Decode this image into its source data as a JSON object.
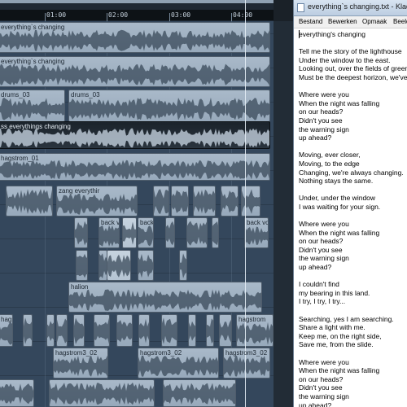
{
  "daw": {
    "ruler": {
      "markers": [
        "01:00",
        "02:00",
        "03:00",
        "04:00"
      ]
    },
    "clips": [
      {
        "id": "c1",
        "label": "everything`s changing"
      },
      {
        "id": "c2",
        "label": "everything`s changing"
      },
      {
        "id": "c3",
        "label": "drums_03"
      },
      {
        "id": "c4",
        "label": "drums_03"
      },
      {
        "id": "c5",
        "label": "ss everythings changing"
      },
      {
        "id": "c6",
        "label": "hagstrom_01"
      },
      {
        "id": "c7",
        "label": "zang everythir"
      },
      {
        "id": "c8",
        "label": "back v"
      },
      {
        "id": "c9",
        "label": "back"
      },
      {
        "id": "c10",
        "label": "back vo"
      },
      {
        "id": "c11",
        "label": "halion"
      },
      {
        "id": "c12",
        "label": "hagstrom"
      },
      {
        "id": "c13",
        "label": "hagstrom"
      },
      {
        "id": "c14",
        "label": "hagstrom3_02"
      },
      {
        "id": "c15",
        "label": "hagstrom3_02"
      },
      {
        "id": "c16",
        "label": "hagstrom3_02"
      }
    ]
  },
  "notepad": {
    "title": "everything`s changing.txt - Kladblok",
    "menu": [
      "Bestand",
      "Bewerken",
      "Opmaak",
      "Beeld"
    ],
    "text": "everything's changing\n\nTell me the story of the lighthouse\nUnder the window to the east.\nLooking out, over the fields of green,\nMust be the deepest horizon, we've\n\nWhere were you\nWhen the night was falling\non our heads?\nDidn't you see\nthe warning sign\nup ahead?\n\nMoving, ever closer,\nMoving, to the edge\nChanging, we're always changing.\nNothing stays the same.\n\nUnder, under the window\nI was waiting for your sign.\n\nWhere were you\nWhen the night was falling\non our heads?\nDidn't you see\nthe warning sign\nup ahead?\n\nI couldn't find\nmy bearing in this land.\nI try, I try, I try...\n\nSearching, yes I am searching.\nShare a light with me.\nKeep me, on the right side,\nSave me, from the slide.\n\nWhere were you\nWhen the night was falling\non our heads?\nDidn't you see\nthe warning sign\nup ahead?"
  }
}
